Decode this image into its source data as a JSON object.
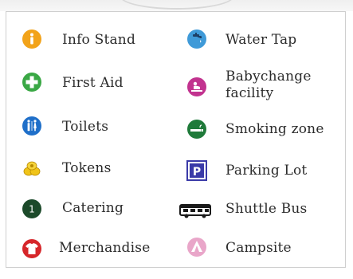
{
  "legend": {
    "left_column": [
      {
        "icon": "info-icon",
        "label": "Info Stand",
        "color": "#f2a31a"
      },
      {
        "icon": "first-aid-icon",
        "label": "First Aid",
        "color": "#3aa845"
      },
      {
        "icon": "toilets-icon",
        "label": "Toilets",
        "color": "#1f6fc9"
      },
      {
        "icon": "tokens-icon",
        "label": "Tokens",
        "color": "#f0c419"
      },
      {
        "icon": "catering-icon",
        "label": "Catering",
        "color": "#1c4a2a"
      },
      {
        "icon": "merchandise-icon",
        "label": "Merchandise",
        "color": "#d6262a"
      }
    ],
    "right_column": [
      {
        "icon": "water-tap-icon",
        "label": "Water Tap",
        "color": "#3f9ad8"
      },
      {
        "icon": "baby-change-icon",
        "label": "Babychange facility",
        "color": "#c2338f"
      },
      {
        "icon": "smoking-icon",
        "label": "Smoking zone",
        "color": "#1f7a3a"
      },
      {
        "icon": "parking-icon",
        "label": "Parking Lot",
        "color": "#3a3aa8"
      },
      {
        "icon": "shuttle-bus-icon",
        "label": "Shuttle Bus",
        "color": "#1a1a1a"
      },
      {
        "icon": "campsite-icon",
        "label": "Campsite",
        "color": "#e9a6c9"
      }
    ],
    "catering_badge": "1",
    "parking_letter": "P"
  }
}
